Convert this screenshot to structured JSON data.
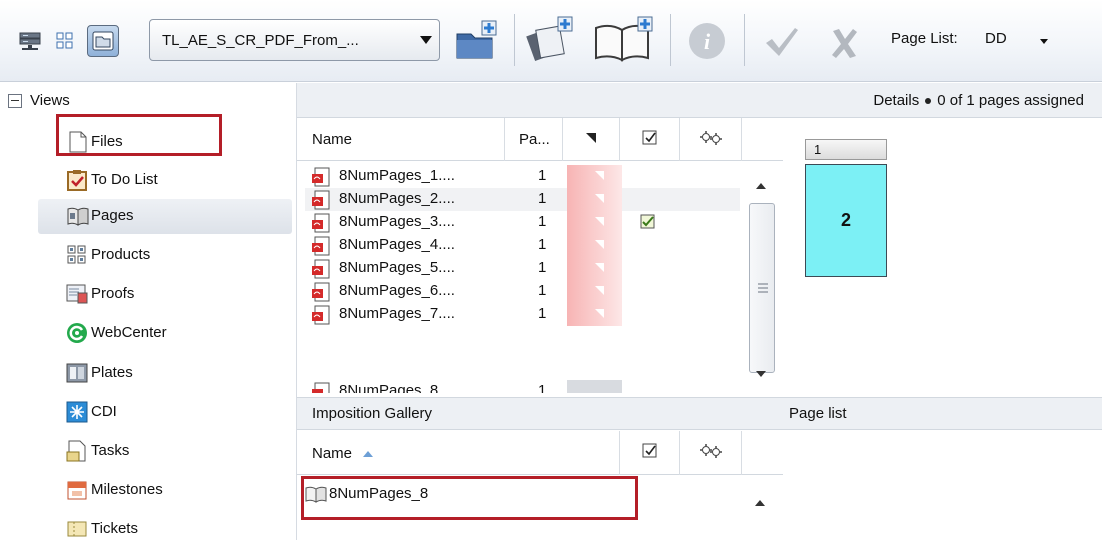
{
  "toolbar": {
    "view_combo_value": "TL_AE_S_CR_PDF_From_...",
    "page_list_label": "Page List:",
    "page_list_value": "DD",
    "icons": [
      "server-icon",
      "grid-view-icon",
      "folder-view-icon",
      "new-folder-icon",
      "add-pages-icon",
      "add-book-icon",
      "info-icon",
      "approve-check-icon",
      "reject-x-icon"
    ]
  },
  "sidebar": {
    "header": "Views",
    "items": [
      {
        "label": "Files",
        "icon": "file-icon"
      },
      {
        "label": "To Do List",
        "icon": "todo-clipboard-icon"
      },
      {
        "label": "Pages",
        "icon": "pages-icon",
        "selected": true
      },
      {
        "label": "Products",
        "icon": "products-grid-icon"
      },
      {
        "label": "Proofs",
        "icon": "proofs-icon"
      },
      {
        "label": "WebCenter",
        "icon": "webcenter-icon"
      },
      {
        "label": "Plates",
        "icon": "plates-icon"
      },
      {
        "label": "CDI",
        "icon": "cdi-icon"
      },
      {
        "label": "Tasks",
        "icon": "tasks-icon"
      },
      {
        "label": "Milestones",
        "icon": "milestones-calendar-icon"
      },
      {
        "label": "Tickets",
        "icon": "tickets-icon"
      }
    ]
  },
  "details": {
    "label": "Details",
    "status": "0 of 1 pages assigned",
    "page_tab": "1",
    "page_number": "2"
  },
  "pages_table": {
    "columns": {
      "name": "Name",
      "pages": "Pa..."
    },
    "rows": [
      {
        "name": "8NumPages_1....",
        "count": "1",
        "approved": false
      },
      {
        "name": "8NumPages_2....",
        "count": "1",
        "approved": false
      },
      {
        "name": "8NumPages_3....",
        "count": "1",
        "approved": true
      },
      {
        "name": "8NumPages_4....",
        "count": "1",
        "approved": false
      },
      {
        "name": "8NumPages_5....",
        "count": "1",
        "approved": false
      },
      {
        "name": "8NumPages_6....",
        "count": "1",
        "approved": false
      },
      {
        "name": "8NumPages_7....",
        "count": "1",
        "approved": false
      }
    ],
    "partial_row": {
      "name": "8NumPages_8...",
      "count": "1"
    }
  },
  "imposition_gallery": {
    "title": "Imposition Gallery",
    "name_column": "Name",
    "rows": [
      {
        "name": "8NumPages_8"
      }
    ]
  },
  "page_list_panel": {
    "title": "Page list"
  }
}
